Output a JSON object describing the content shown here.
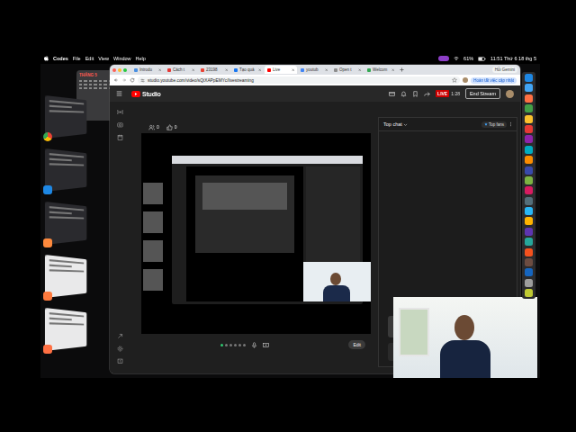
{
  "menu_bar": {
    "app": "Codes",
    "items": [
      "File",
      "Edit",
      "View",
      "Window",
      "Help"
    ],
    "battery": "61%",
    "clock": "11:51 Thứ 6 18 thg 5"
  },
  "calendar_widget": {
    "month": "THÁNG 5"
  },
  "stage_manager": [
    {
      "kind": "browser"
    },
    {
      "kind": "editor"
    },
    {
      "kind": "terminal"
    },
    {
      "kind": "document"
    },
    {
      "kind": "board"
    }
  ],
  "browser": {
    "tabs": [
      {
        "label": "Introdu",
        "selected": false,
        "color": "#4a90e2"
      },
      {
        "label": "Cách t",
        "selected": false,
        "color": "#e53935"
      },
      {
        "label": "23198",
        "selected": false,
        "color": "#ea4335"
      },
      {
        "label": "Tạo quả",
        "selected": false,
        "color": "#1877f2"
      },
      {
        "label": "Live",
        "selected": true,
        "color": "#ff0000"
      },
      {
        "label": "youtub",
        "selected": false,
        "color": "#4285f4"
      },
      {
        "label": "Open t",
        "selected": false,
        "color": "#8e8e8e"
      },
      {
        "label": "Welcom",
        "selected": false,
        "color": "#34a853"
      }
    ],
    "url": "studio.youtube.com/video/sQtXAPpEMYc/livestreaming",
    "update_button": "Hoàn tất việc cập nhật",
    "gemini": "Hỏi Gemini"
  },
  "studio": {
    "logo": "Studio",
    "live_badge": "LIVE",
    "elapsed": "1:28",
    "end_stream": "End Stream",
    "stats": [
      {
        "kind": "viewers",
        "value": "0"
      },
      {
        "kind": "likes",
        "value": "0"
      }
    ],
    "dots": [
      {
        "selected": true
      },
      {
        "selected": false
      },
      {
        "selected": false
      },
      {
        "selected": false
      },
      {
        "selected": false
      },
      {
        "selected": false
      }
    ],
    "edit": "Edit",
    "chat": {
      "title": "Top chat",
      "top_fans": "Top fans"
    }
  },
  "dock": [
    {
      "color": "#1e88e5"
    },
    {
      "color": "#42a5f5"
    },
    {
      "color": "#ff7043"
    },
    {
      "color": "#43a047"
    },
    {
      "color": "#fbc02d"
    },
    {
      "color": "#e53935"
    },
    {
      "color": "#8e24aa"
    },
    {
      "color": "#00acc1"
    },
    {
      "color": "#fb8c00"
    },
    {
      "color": "#3949ab"
    },
    {
      "color": "#7cb342"
    },
    {
      "color": "#d81b60"
    },
    {
      "color": "#546e7a"
    },
    {
      "color": "#29b6f6"
    },
    {
      "color": "#ffb300"
    },
    {
      "color": "#5e35b1"
    },
    {
      "color": "#26a69a"
    },
    {
      "color": "#f4511e"
    },
    {
      "color": "#6d4c41"
    },
    {
      "color": "#1565c0"
    },
    {
      "color": "#9e9e9e"
    },
    {
      "color": "#c0ca33"
    }
  ]
}
